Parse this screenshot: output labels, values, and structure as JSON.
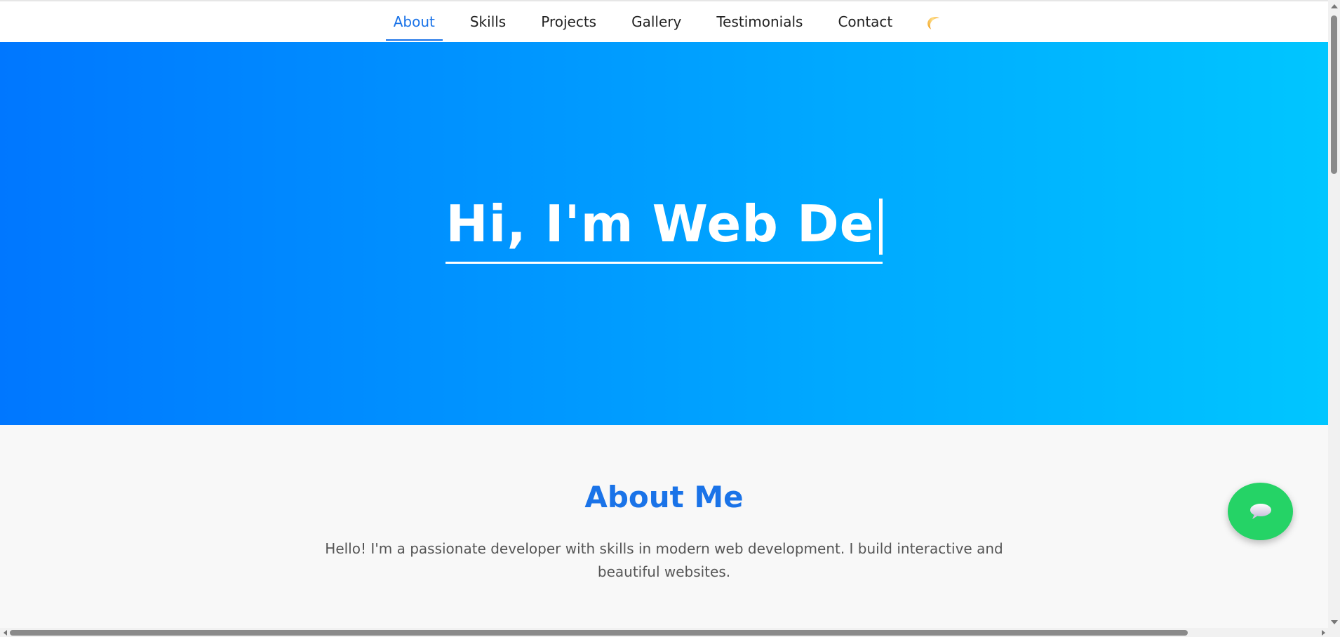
{
  "nav": {
    "items": [
      {
        "label": "About",
        "active": true
      },
      {
        "label": "Skills",
        "active": false
      },
      {
        "label": "Projects",
        "active": false
      },
      {
        "label": "Gallery",
        "active": false
      },
      {
        "label": "Testimonials",
        "active": false
      },
      {
        "label": "Contact",
        "active": false
      }
    ],
    "theme_toggle_icon": "moon-icon"
  },
  "hero": {
    "typed_text": "Hi, I'm Web De",
    "gradient_start": "#0077ff",
    "gradient_end": "#00c6ff"
  },
  "about": {
    "title": "About Me",
    "body": "Hello! I'm a passionate developer with skills in modern web development. I build interactive and beautiful websites."
  },
  "chat_fab": {
    "icon": "chat-bubble-icon",
    "color": "#25d366"
  },
  "colors": {
    "accent": "#1a73e8",
    "text": "#222222",
    "muted": "#555555",
    "background": "#f8f8f8"
  }
}
